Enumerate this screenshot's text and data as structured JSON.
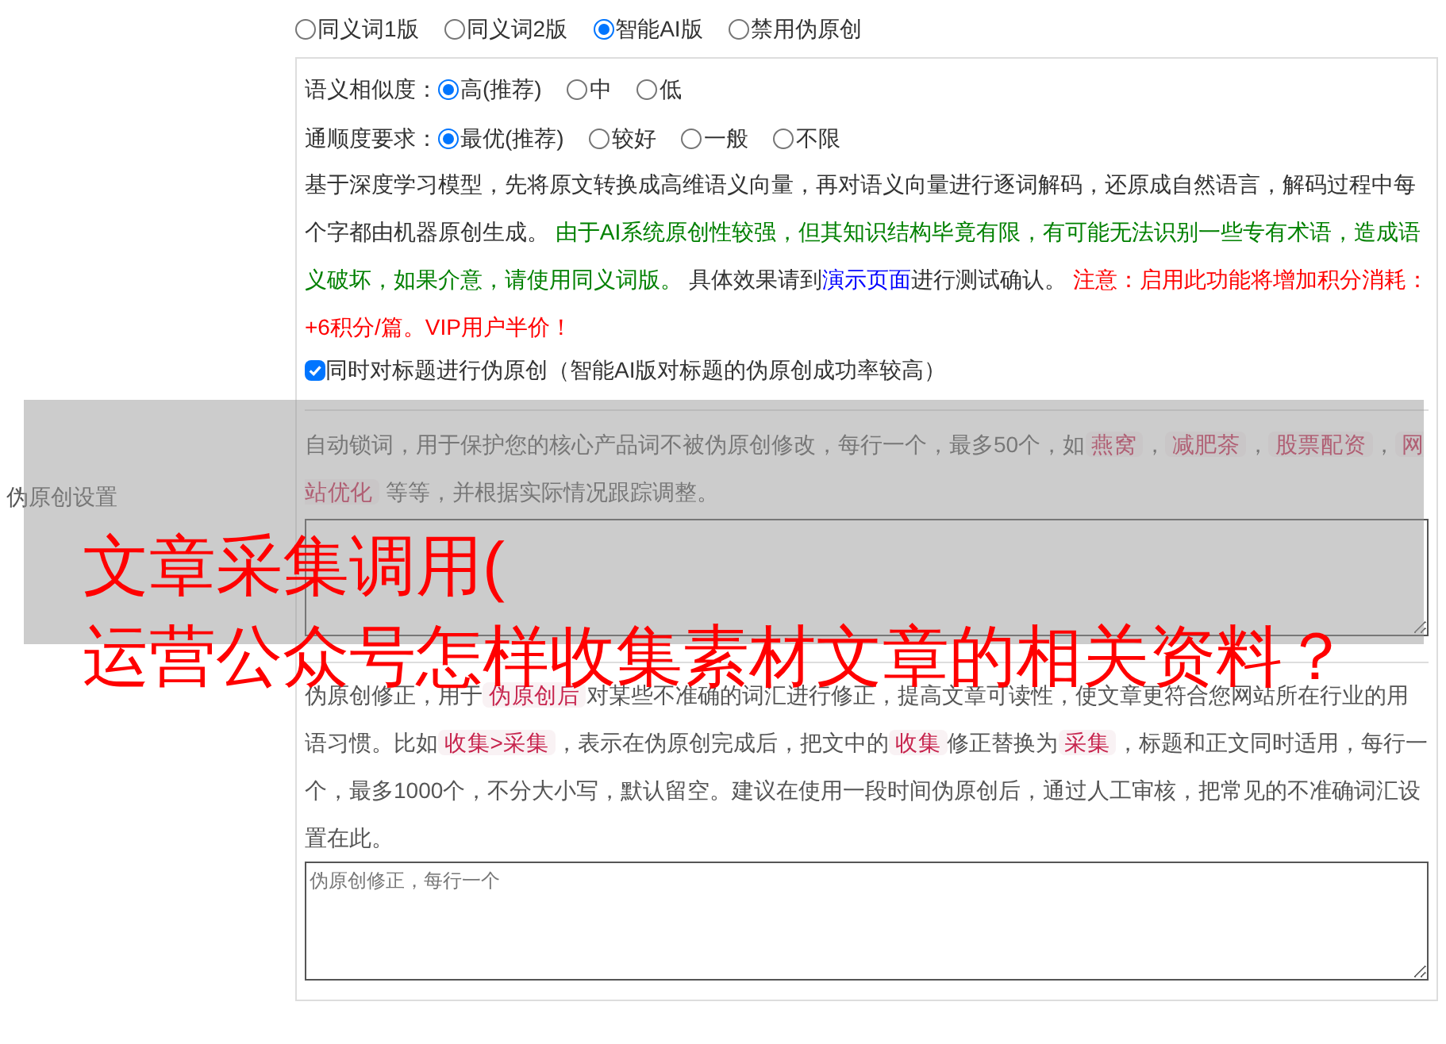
{
  "section_label": "伪原创设置",
  "modes": [
    {
      "label": "同义词1版",
      "selected": false
    },
    {
      "label": "同义词2版",
      "selected": false
    },
    {
      "label": "智能AI版",
      "selected": true
    },
    {
      "label": "禁用伪原创",
      "selected": false
    }
  ],
  "similarity": {
    "label": "语义相似度：",
    "options": [
      {
        "label": "高(推荐)",
        "selected": true
      },
      {
        "label": "中",
        "selected": false
      },
      {
        "label": "低",
        "selected": false
      }
    ]
  },
  "fluency": {
    "label": "通顺度要求：",
    "options": [
      {
        "label": "最优(推荐)",
        "selected": true
      },
      {
        "label": "较好",
        "selected": false
      },
      {
        "label": "一般",
        "selected": false
      },
      {
        "label": "不限",
        "selected": false
      }
    ]
  },
  "ai_description": [
    {
      "kind": "text",
      "text": "基于深度学习模型，先将原文转换成高维语义向量，再对语义向量进行逐词解码，还原成自然语言，解码过程中每个字都由机器原创生成。 "
    },
    {
      "kind": "note",
      "text": "由于AI系统原创性较强，但其知识结构毕竟有限，有可能无法识别一些专有术语，造成语义破坏，如果介意，请使用同义词版。"
    },
    {
      "kind": "text",
      "text": " 具体效果请到"
    },
    {
      "kind": "link",
      "text": "演示页面"
    },
    {
      "kind": "text",
      "text": "进行测试确认。 "
    },
    {
      "kind": "warning",
      "text": "注意：启用此功能将增加积分消耗：+6积分/篇。VIP用户半价！"
    }
  ],
  "title_option": {
    "label": "同时对标题进行伪原创（智能AI版对标题的伪原创成功率较高）",
    "checked": true
  },
  "lock_description": [
    {
      "kind": "text",
      "text": "自动锁词，用于保护您的核心产品词不被伪原创修改，每行一个，最多50个，如"
    },
    {
      "kind": "code",
      "text": "燕窝"
    },
    {
      "kind": "text",
      "text": "，"
    },
    {
      "kind": "code",
      "text": "减肥茶"
    },
    {
      "kind": "text",
      "text": "，"
    },
    {
      "kind": "code",
      "text": "股票配资"
    },
    {
      "kind": "text",
      "text": "，"
    },
    {
      "kind": "code",
      "text": "网站优化"
    },
    {
      "kind": "text",
      "text": " 等等，并根据实际情况跟踪调整。"
    }
  ],
  "correction_description": [
    {
      "kind": "text",
      "text": "伪原创修正，用于"
    },
    {
      "kind": "code",
      "text": "伪原创后"
    },
    {
      "kind": "text",
      "text": "对某些不准确的词汇进行修正，提高文章可读性，使文章更符合您网站所在行业的用语习惯。比如"
    },
    {
      "kind": "code",
      "text": "收集>采集"
    },
    {
      "kind": "text",
      "text": "，表示在伪原创完成后，把文中的"
    },
    {
      "kind": "code",
      "text": "收集"
    },
    {
      "kind": "text",
      "text": "修正替换为"
    },
    {
      "kind": "code",
      "text": "采集"
    },
    {
      "kind": "text",
      "text": "，标题和正文同时适用，每行一个，最多1000个，不分大小写，默认留空。建议在使用一段时间伪原创后，通过人工审核，把常见的不准确词汇设置在此。"
    }
  ],
  "correction_field": {
    "placeholder": "伪原创修正，每行一个"
  },
  "overlay": {
    "lines": [
      "文章采集调用(",
      "运营公众号怎样收集素材文章的相关资料？"
    ]
  }
}
